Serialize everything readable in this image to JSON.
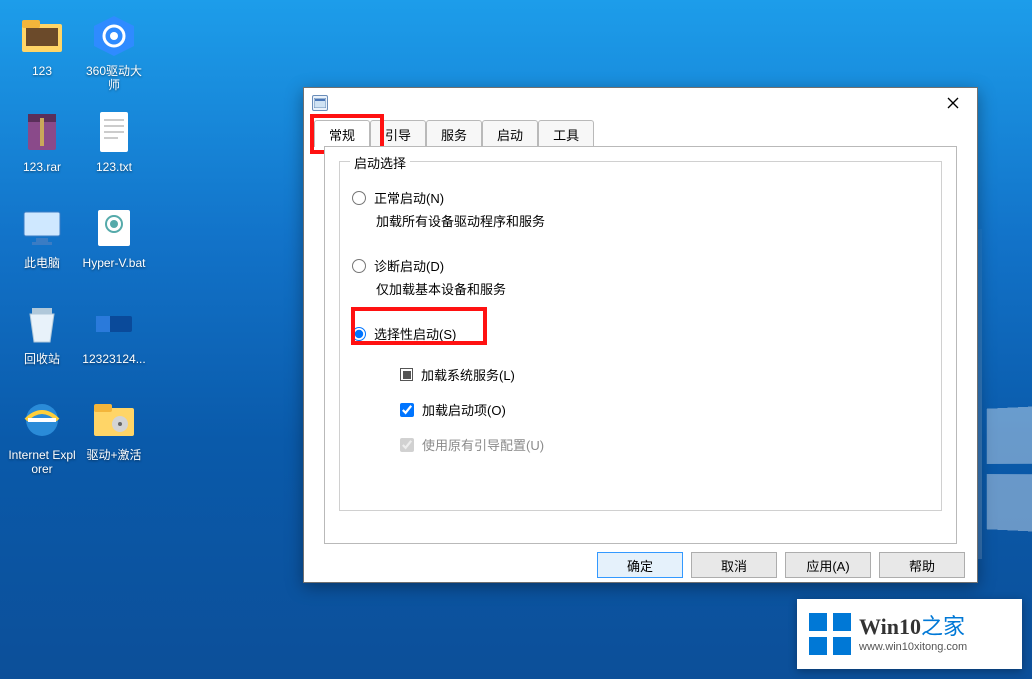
{
  "desktop": {
    "icons": [
      {
        "label": "123",
        "kind": "folder-photo"
      },
      {
        "label": "360驱动大师",
        "kind": "app-360"
      },
      {
        "label": "123.rar",
        "kind": "rar"
      },
      {
        "label": "123.txt",
        "kind": "txt"
      },
      {
        "label": "此电脑",
        "kind": "pc"
      },
      {
        "label": "Hyper-V.bat",
        "kind": "bat"
      },
      {
        "label": "回收站",
        "kind": "bin"
      },
      {
        "label": "12323124...",
        "kind": "segment"
      },
      {
        "label": "Internet Explorer",
        "kind": "ie"
      },
      {
        "label": "驱动+激活",
        "kind": "folder-cd"
      }
    ]
  },
  "msconfig": {
    "tabs": [
      "常规",
      "引导",
      "服务",
      "启动",
      "工具"
    ],
    "active_tab": 0,
    "group_title": "启动选择",
    "options": {
      "normal": {
        "label": "正常启动(N)",
        "desc": "加载所有设备驱动程序和服务",
        "checked": false
      },
      "diagnostic": {
        "label": "诊断启动(D)",
        "desc": "仅加载基本设备和服务",
        "checked": false
      },
      "selective": {
        "label": "选择性启动(S)",
        "checked": true,
        "children": {
          "load_services": {
            "label": "加载系统服务(L)",
            "state": "mixed"
          },
          "load_startup": {
            "label": "加载启动项(O)",
            "state": "checked"
          },
          "use_boot": {
            "label": "使用原有引导配置(U)",
            "state": "disabled-checked"
          }
        }
      }
    },
    "buttons": {
      "ok": "确定",
      "cancel": "取消",
      "apply": "应用(A)",
      "help": "帮助"
    }
  },
  "watermark": {
    "title_a": "Win10",
    "title_b": "之家",
    "url": "www.win10xitong.com"
  }
}
